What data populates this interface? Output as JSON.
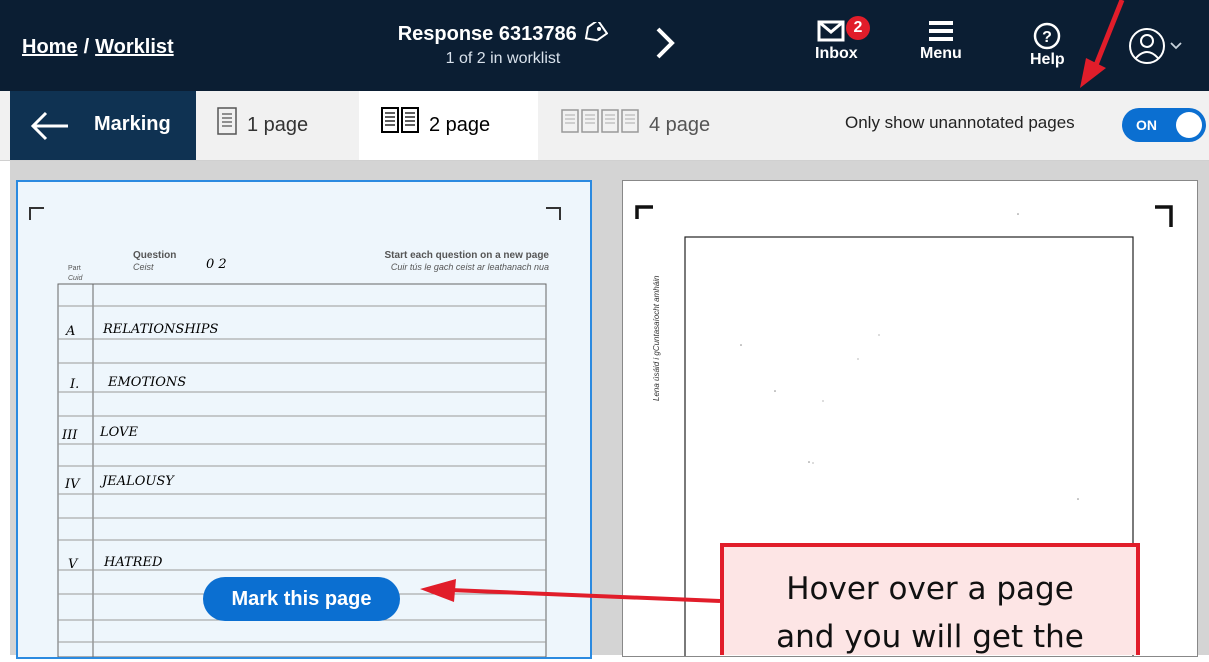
{
  "breadcrumb": {
    "home": "Home",
    "separator": "/",
    "worklist": "Worklist"
  },
  "response": {
    "title": "Response 6313786",
    "subtitle": "1 of 2 in worklist",
    "tag_icon": "tag-icon"
  },
  "nav": {
    "next_icon": "chevron-right-icon"
  },
  "toolbar": {
    "inbox_label": "Inbox",
    "inbox_count": "2",
    "menu_label": "Menu",
    "help_label": "Help"
  },
  "subbar": {
    "marking_label": "Marking",
    "view_options": [
      "1 page",
      "2 page",
      "4 page"
    ],
    "selected_view": "2 page",
    "filter_label": "Only show unannotated pages",
    "toggle_state": "ON"
  },
  "page1": {
    "question_label": "Question",
    "question_label_irish": "Ceist",
    "part_label": "Part",
    "part_label_irish": "Cuid",
    "question_number": "0   2",
    "instruction": "Start each question on a new page",
    "instruction_irish": "Cuir tús le gach ceist ar leathanach nua",
    "rows": [
      {
        "part": "A",
        "answer": "RELATIONSHIPS"
      },
      {
        "part": "I.",
        "answer": "EMOTIONS"
      },
      {
        "part": "III",
        "answer": "LOVE"
      },
      {
        "part": "IV",
        "answer": "JEALOUSY"
      },
      {
        "part": "",
        "answer": ""
      },
      {
        "part": "V",
        "answer": "HATRED"
      }
    ]
  },
  "page2": {
    "side_text": "Lena úsáid i gCuntasaíocht amháin"
  },
  "mark_button": "Mark this page",
  "callout": {
    "line1": "Hover over a page",
    "line2": "and you will get the"
  },
  "colors": {
    "topbar": "#0b1e33",
    "accent": "#0b6fd1",
    "callout_border": "#e11d2a",
    "callout_fill": "#fde5e5"
  }
}
